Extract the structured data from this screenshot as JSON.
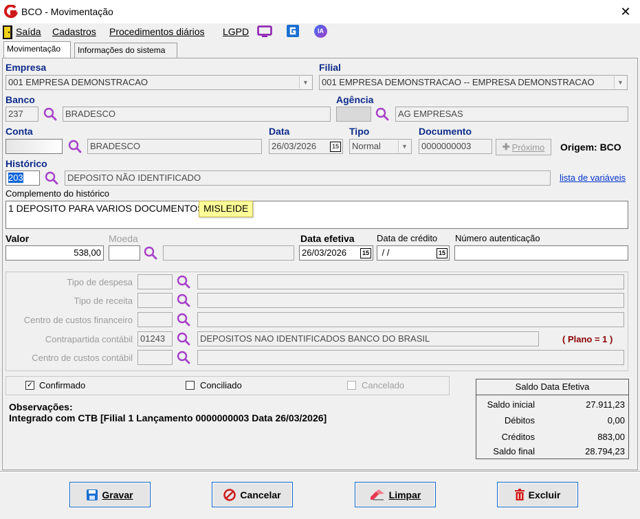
{
  "window": {
    "title": "BCO - Movimentação"
  },
  "menu": {
    "saida": "Saída",
    "cadastros": "Cadastros",
    "procedimentos": "Procedimentos diários",
    "lgpd": "LGPD",
    "ia_badge": "IA"
  },
  "tabs": [
    {
      "label": "Movimentação"
    },
    {
      "label": "Informações do sistema"
    }
  ],
  "form": {
    "empresa": {
      "label": "Empresa",
      "value": "001 EMPRESA DEMONSTRACAO"
    },
    "filial": {
      "label": "Filial",
      "value": "001 EMPRESA DEMONSTRACAO -- EMPRESA DEMONSTRACAO"
    },
    "banco": {
      "label": "Banco",
      "code": "237",
      "name": "BRADESCO"
    },
    "agencia": {
      "label": "Agência",
      "code": "",
      "name": "AG EMPRESAS"
    },
    "conta": {
      "label": "Conta",
      "code": "",
      "name": "BRADESCO"
    },
    "data": {
      "label": "Data",
      "value": "26/03/2026"
    },
    "tipo": {
      "label": "Tipo",
      "value": "Normal"
    },
    "documento": {
      "label": "Documento",
      "value": "0000000003"
    },
    "proximo_button": "Próximo",
    "origem": "Origem: BCO",
    "historico": {
      "label": "Histórico",
      "code": "203",
      "name": "DEPOSITO NÃO IDENTIFICADO"
    },
    "lista_variaveis": "lista de variáveis",
    "complemento": {
      "label": "Complemento do histórico",
      "value": "1 DEPOSITO PARA VARIOS DOCUMENTOS -",
      "tooltip": "MISLEIDE"
    },
    "valor": {
      "label": "Valor",
      "value": "538,00"
    },
    "moeda": {
      "label": "Moeda",
      "code": "",
      "name": ""
    },
    "data_efetiva": {
      "label": "Data efetiva",
      "value": "26/03/2026"
    },
    "data_credito": {
      "label": "Data de crédito",
      "value": " / /"
    },
    "numero_autenticacao": {
      "label": "Número autenticação",
      "value": ""
    },
    "calendar_glyph": "15"
  },
  "classificacao": {
    "tipo_despesa": {
      "label": "Tipo de despesa",
      "code": "",
      "name": ""
    },
    "tipo_receita": {
      "label": "Tipo de receita",
      "code": "",
      "name": ""
    },
    "centro_financeiro": {
      "label": "Centro de custos financeiro",
      "code": "",
      "name": ""
    },
    "contrapartida": {
      "label": "Contrapartida contábil",
      "code": "01243",
      "name": "DEPOSITOS NAO IDENTIFICADOS BANCO DO BRASIL"
    },
    "centro_contabil": {
      "label": "Centro de custos contábil",
      "code": "",
      "name": ""
    },
    "plano": "( Plano = 1 )"
  },
  "status": {
    "confirmado": {
      "label": "Confirmado",
      "checked": true
    },
    "conciliado": {
      "label": "Conciliado",
      "checked": false
    },
    "cancelado": {
      "label": "Cancelado",
      "checked": false
    }
  },
  "observacoes": {
    "label": "Observações:",
    "text": "Integrado com CTB [Filial 1 Lançamento 0000000003 Data 26/03/2026]"
  },
  "saldo": {
    "title": "Saldo Data Efetiva",
    "rows": [
      {
        "label": "Saldo inicial",
        "value": "27.911,23"
      },
      {
        "label": "Débitos",
        "value": "0,00"
      },
      {
        "label": "Créditos",
        "value": "883,00"
      },
      {
        "label": "Saldo final",
        "value": "28.794,23"
      }
    ]
  },
  "buttons": {
    "gravar": "Gravar",
    "cancelar": "Cancelar",
    "limpar": "Limpar",
    "excluir": "Excluir"
  },
  "colors": {
    "label_blue": "#0b2a8a",
    "accent_purple": "#a640c8",
    "link_blue": "#0033cc",
    "plano_red": "#8b0000",
    "tooltip_yellow": "#ffff99"
  }
}
